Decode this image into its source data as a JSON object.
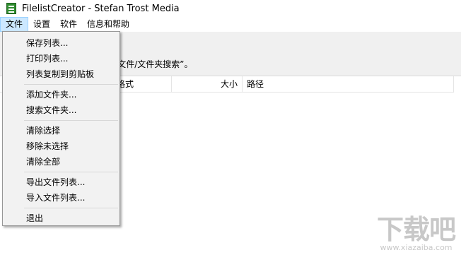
{
  "window": {
    "title": "FilelistCreator - Stefan Trost Media"
  },
  "menubar": {
    "items": [
      "文件",
      "设置",
      "软件",
      "信息和帮助"
    ]
  },
  "hint": {
    "text": "用程序，或者你可以点击“添加文件/文件夹搜索”。"
  },
  "list": {
    "columns": [
      "格式",
      "大小",
      "路径"
    ]
  },
  "file_menu": {
    "items": [
      "保存列表...",
      "打印列表...",
      "列表复制到剪贴板",
      "添加文件夹...",
      "搜索文件夹...",
      "清除选择",
      "移除未选择",
      "清除全部",
      "导出文件列表...",
      "导入文件列表...",
      "退出"
    ]
  },
  "watermark": {
    "main": "下载吧",
    "sub": "www.xiazaiba.com"
  },
  "colors": {
    "menu_active_bg": "#cce8ff",
    "menu_active_border": "#99d1ff",
    "dropdown_bg": "#f2f2f2",
    "toolbar_bg": "#f0f0f0"
  }
}
